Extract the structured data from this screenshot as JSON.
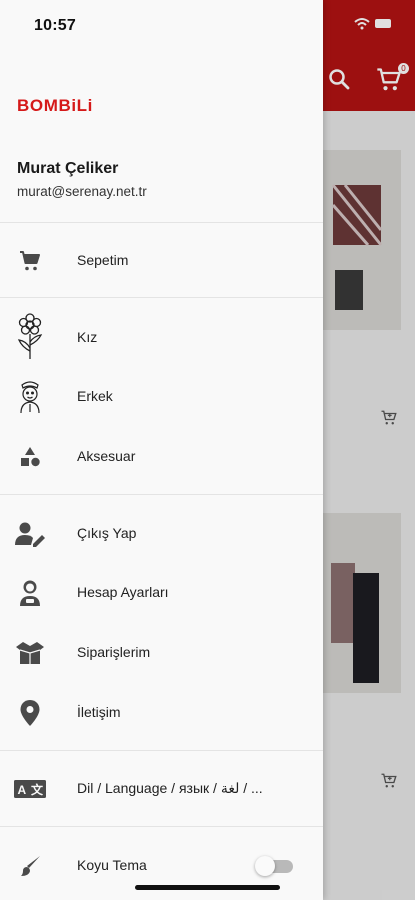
{
  "status_bar": {
    "time": "10:57"
  },
  "brand": {
    "name": "BOMBiLi",
    "color": "#d51919"
  },
  "user": {
    "name": "Murat Çeliker",
    "email": "murat@serenay.net.tr"
  },
  "background": {
    "header_color": "#b31313",
    "cart_badge": "0",
    "icons": [
      "search-icon",
      "cart-icon",
      "add-to-cart-icon"
    ]
  },
  "menu": {
    "cart": {
      "label": "Sepetim",
      "icon": "cart-icon"
    },
    "categories": [
      {
        "label": "Kız",
        "icon": "flower-girl-icon"
      },
      {
        "label": "Erkek",
        "icon": "boy-icon"
      },
      {
        "label": "Aksesuar",
        "icon": "shapes-icon"
      }
    ],
    "account": [
      {
        "label": "Çıkış Yap",
        "icon": "user-edit-icon"
      },
      {
        "label": "Hesap Ayarları",
        "icon": "user-settings-icon"
      },
      {
        "label": "Siparişlerim",
        "icon": "box-icon"
      },
      {
        "label": "İletişim",
        "icon": "location-pin-icon"
      }
    ],
    "language": {
      "label": "Dil / Language / язык / لغة / ...",
      "icon": "translate-icon"
    },
    "theme": {
      "label": "Koyu Tema",
      "icon": "brush-icon",
      "enabled": false
    }
  }
}
